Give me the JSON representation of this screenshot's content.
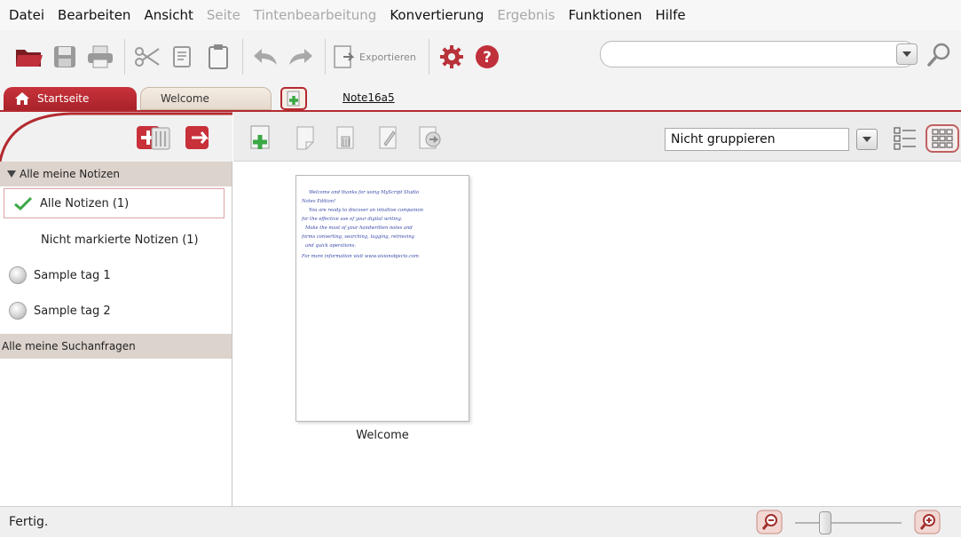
{
  "menu": {
    "items": [
      {
        "label": "Datei",
        "enabled": true
      },
      {
        "label": "Bearbeiten",
        "enabled": true
      },
      {
        "label": "Ansicht",
        "enabled": true
      },
      {
        "label": "Seite",
        "enabled": false
      },
      {
        "label": "Tintenbearbeitung",
        "enabled": false
      },
      {
        "label": "Konvertierung",
        "enabled": true
      },
      {
        "label": "Ergebnis",
        "enabled": false
      },
      {
        "label": "Funktionen",
        "enabled": true
      },
      {
        "label": "Hilfe",
        "enabled": true
      }
    ]
  },
  "toolbar": {
    "export_label": "Exportieren",
    "search_value": "",
    "icons": [
      "open-folder-icon",
      "save-icon",
      "print-icon",
      "cut-icon",
      "copy-icon",
      "paste-icon",
      "undo-icon",
      "redo-icon",
      "settings-gear-icon",
      "help-icon"
    ]
  },
  "tabs": {
    "start_label": "Startseite",
    "welcome_label": "Welcome",
    "note_link": "Note16a5"
  },
  "sidebar": {
    "group_notes": "Alle meine Notizen",
    "items": [
      {
        "label": "Alle Notizen (1)",
        "selected": true
      },
      {
        "label": "Nicht markierte Notizen (1)",
        "selected": false
      }
    ],
    "tags": [
      "Sample tag 1",
      "Sample tag 2"
    ],
    "group_searches": "Alle meine Suchanfragen"
  },
  "main": {
    "group_by": "Nicht gruppieren",
    "notes": [
      {
        "title": "Welcome",
        "handwriting": [
          "Welcome and thanks for using MyScript Studio",
          "Notes Edition!",
          "You are ready to discover an intuitive companion",
          "for the effective use of your digital writing.",
          "Make the most of your handwritten notes and",
          "forms converting, searching, tagging, retrieving",
          "and quick operations.",
          "For more information visit www.visionobjects.com"
        ]
      }
    ]
  },
  "status": {
    "text": "Fertig.",
    "zoom_level": 0.28
  },
  "colors": {
    "accent": "#b32a2f",
    "group_header": "#dcd3cc",
    "handwriting_ink": "#3a4aa8",
    "check_green": "#3aa845"
  }
}
